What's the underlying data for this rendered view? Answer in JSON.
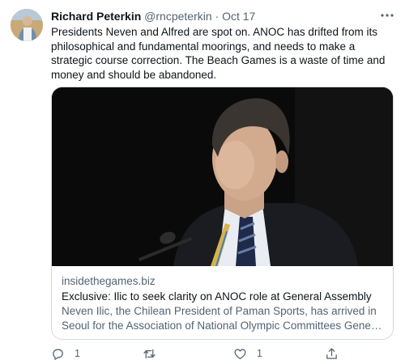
{
  "tweet": {
    "author_name": "Richard Peterkin",
    "author_handle": "@rncpeterkin",
    "separator": "·",
    "timestamp": "Oct 17",
    "more_icon": "more-horizontal-icon",
    "text": "Presidents Neven and Alfred are spot on. ANOC has drifted from its philosophical and fundamental moorings, and needs to make a strategic course correction. The Beach Games is a waste of time and money and should be abandoned."
  },
  "card": {
    "domain": "insidethegames.biz",
    "title": "Exclusive: Ilic to seek clarity on ANOC role at General Assembly",
    "description": "Neven Ilic, the Chilean President of Paman Sports, has arrived in Seoul for the Association of National Olympic Committees General Assembly..."
  },
  "actions": {
    "reply": {
      "icon": "reply-icon",
      "count": "1"
    },
    "retweet": {
      "icon": "retweet-icon",
      "count": ""
    },
    "like": {
      "icon": "heart-icon",
      "count": "1"
    },
    "share": {
      "icon": "share-icon",
      "count": ""
    }
  },
  "colors": {
    "text": "#0f1419",
    "secondary": "#536471",
    "border": "#cfd9de",
    "photo_bg": "#0a0a0a"
  }
}
